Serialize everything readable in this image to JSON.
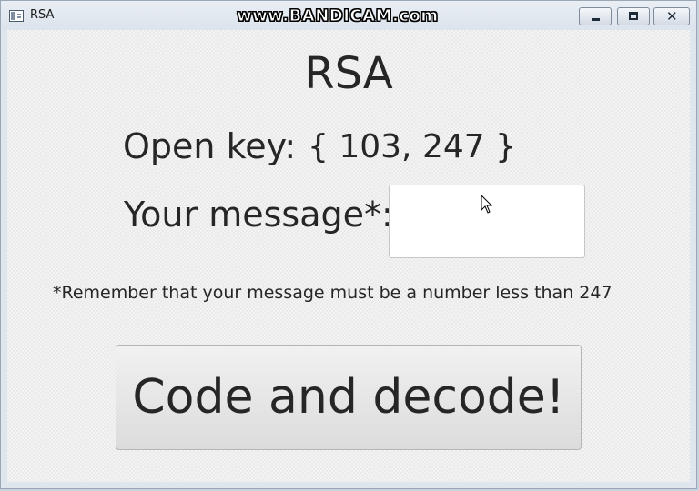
{
  "window": {
    "title": "RSA",
    "watermark": "www.BANDICAM.com"
  },
  "titlebar": {
    "buttons": [
      "minimize-icon",
      "maximize-icon",
      "close-icon"
    ]
  },
  "main": {
    "heading": "RSA",
    "open_key_label": "Open key:",
    "open_key_value": "{ 103, 247 }",
    "message_label": "Your message*:",
    "message_input_value": "",
    "note": "*Remember that your message must be a number less than 247",
    "action_button": "Code and decode!"
  },
  "icons": {
    "app": "window-app-icon",
    "cursor": "mouse-pointer-icon"
  }
}
